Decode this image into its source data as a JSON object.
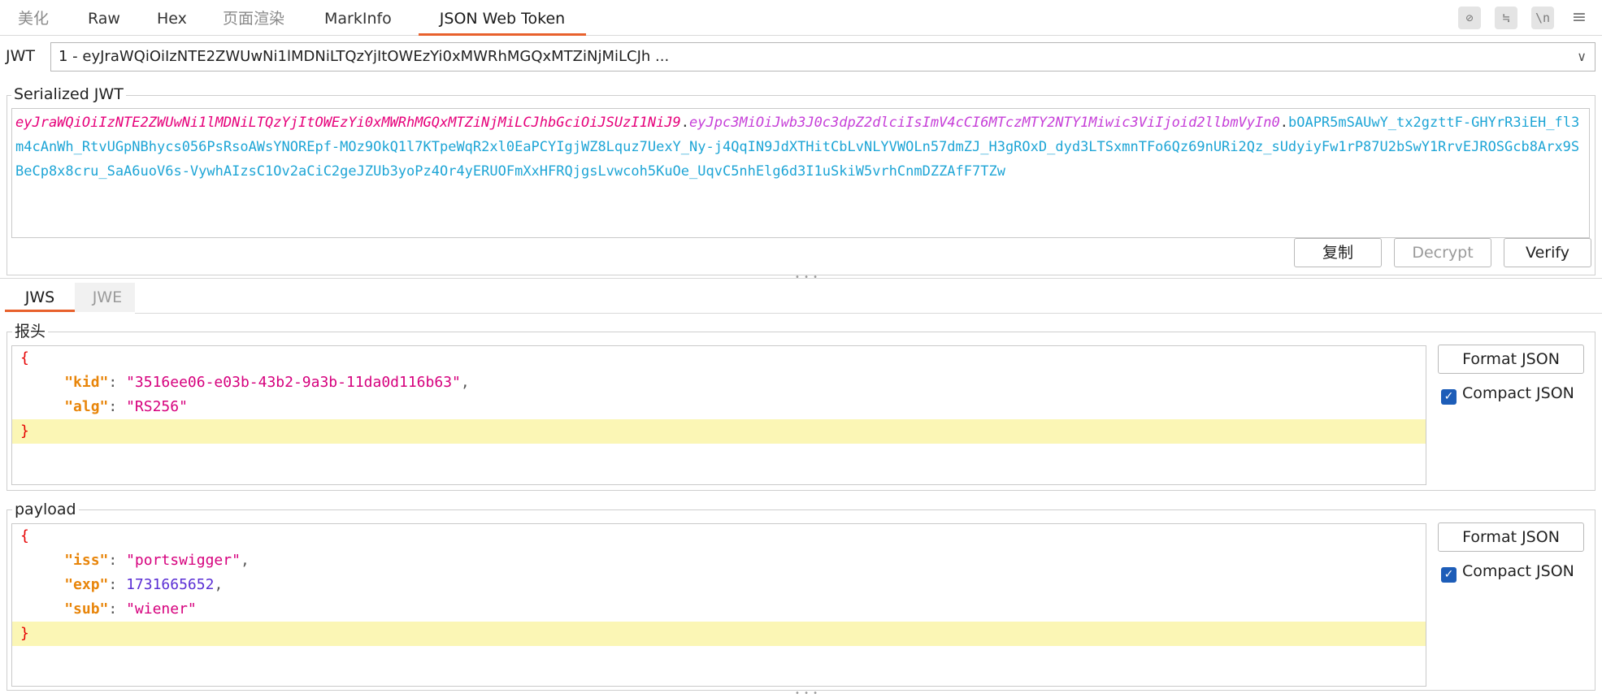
{
  "top_tabs": [
    {
      "label": "美化",
      "state": "muted"
    },
    {
      "label": "Raw",
      "state": "normal"
    },
    {
      "label": "Hex",
      "state": "normal"
    },
    {
      "label": "页面渲染",
      "state": "muted"
    },
    {
      "label": "MarkInfo",
      "state": "normal"
    },
    {
      "label": "JSON Web Token",
      "state": "active"
    }
  ],
  "toolbar_icons": [
    {
      "name": "hide-icon",
      "glyph": "⊘"
    },
    {
      "name": "wrap-icon",
      "glyph": "≒"
    },
    {
      "name": "newline-icon",
      "glyph": "\\n"
    },
    {
      "name": "menu-icon",
      "glyph": "≡"
    }
  ],
  "jwt_selector": {
    "label": "JWT",
    "value": "1 - eyJraWQiOiIzNTE2ZWUwNi1lMDNiLTQzYjItOWEzYi0xMWRhMGQxMTZiNjMiLCJh ..."
  },
  "serialized": {
    "legend": "Serialized JWT",
    "header_part": "eyJraWQiOiIzNTE2ZWUwNi1lMDNiLTQzYjItOWEzYi0xMWRhMGQxMTZiNjMiLCJhbGciOiJSUzI1NiJ9",
    "dot1": ".",
    "payload_part": "eyJpc3MiOiJwb3J0c3dpZ2dlciIsImV4cCI6MTczMTY2NTY1Miwic3ViIjoid2llbmVyIn0",
    "dot2": ".",
    "signature_part": "bOAPR5mSAUwY_tx2gzttF-GHYrR3iEH_fl3m4cAnWh_RtvUGpNBhycs056PsRsoAWsYNOREpf-MOz9OkQ1l7KTpeWqR2xl0EaPCYIgjWZ8Lquz7UexY_Ny-j4QqIN9JdXTHitCbLvNLYVWOLn57dmZJ_H3gROxD_dyd3LTSxmnTFo6Qz69nURi2Qz_sUdyiyFw1rP87U2bSwY1RrvEJROSGcb8Arx9SBeCp8x8cru_SaA6uoV6s-VywhAIzsC1Ov2aCiC2geJZUb3yoPz4Or4yERUOFmXxHFRQjgsLvwcoh5KuOe_UqvC5nhElg6d3I1uSkiW5vrhCnmDZZAfF7TZw"
  },
  "actions": {
    "copy": "复制",
    "decrypt": "Decrypt",
    "verify": "Verify"
  },
  "sub_tabs": [
    {
      "label": "JWS",
      "state": "active"
    },
    {
      "label": "JWE",
      "state": "muted"
    }
  ],
  "header_section": {
    "legend": "报头",
    "kid_key": "\"kid\"",
    "kid_value": "\"3516ee06-e03b-43b2-9a3b-11da0d116b63\"",
    "alg_key": "\"alg\"",
    "alg_value": "\"RS256\"",
    "format_button": "Format JSON",
    "compact_label": "Compact JSON",
    "compact_checked": true
  },
  "payload_section": {
    "legend": "payload",
    "iss_key": "\"iss\"",
    "iss_value": "\"portswigger\"",
    "exp_key": "\"exp\"",
    "exp_value": "1731665652",
    "sub_key": "\"sub\"",
    "sub_value": "\"wiener\"",
    "format_button": "Format JSON",
    "compact_label": "Compact JSON",
    "compact_checked": true
  },
  "syntax": {
    "open_brace": "{",
    "close_brace": "}",
    "colon": ": ",
    "comma": ","
  },
  "colors": {
    "accent": "#e8612c",
    "header_segment": "#e6007a",
    "payload_segment": "#c63fd8",
    "signature_segment": "#1ea5d6",
    "highlight_line": "#fbf6b5",
    "checkbox": "#1d5db8"
  }
}
